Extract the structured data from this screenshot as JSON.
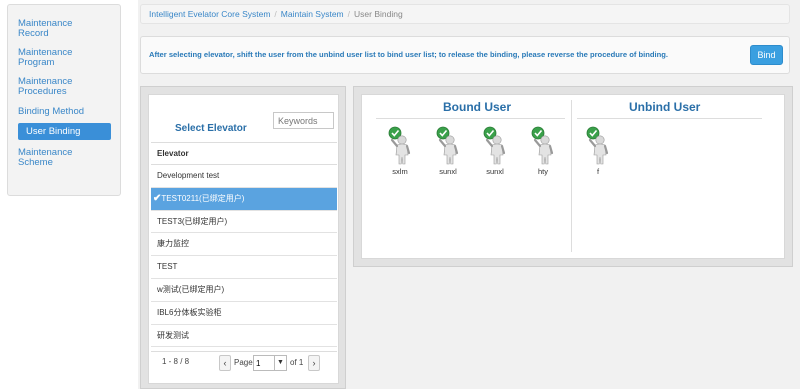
{
  "sidebar": {
    "items": [
      {
        "line1": "Maintenance",
        "line2": "Record"
      },
      {
        "line1": "Maintenance",
        "line2": "Program"
      },
      {
        "line1": "Maintenance",
        "line2": "Procedures"
      },
      {
        "line1": "Binding Method",
        "line2": ""
      },
      {
        "line1": "User Binding",
        "line2": ""
      },
      {
        "line1": "Maintenance",
        "line2": "Scheme"
      }
    ],
    "active_index": 4
  },
  "breadcrumb": {
    "items": [
      "Intelligent Evelator Core System",
      "Maintain System",
      "User Binding"
    ],
    "separator": "/"
  },
  "notice": {
    "text": "After selecting elevator, shift the user from the unbind user list to bind user list; to release the binding, please reverse the procedure of binding.",
    "bind_label": "Bind"
  },
  "elevator_panel": {
    "title": "Select Elevator",
    "keyword_placeholder": "Keywords",
    "column_header": "Elevator",
    "rows": [
      "Development test",
      "TEST0211(已绑定用户)",
      "TEST3(已绑定用户)",
      "康力监控",
      "TEST",
      "w测试(已绑定用户)",
      "IBL6分体板实验柜",
      "研发测试"
    ],
    "selected_index": 1,
    "pager": {
      "count": "1 - 8 / 8",
      "page_label": "Page",
      "page_value": "1",
      "of_label": "of 1",
      "prev": "‹",
      "next": "›",
      "dropdown": "▼"
    }
  },
  "user_panel": {
    "bound_title": "Bound User",
    "unbind_title": "Unbind User",
    "bound_users": [
      "sxlm",
      "sunxl",
      "sunxl",
      "hty"
    ],
    "unbind_users": [
      "f"
    ]
  },
  "colors": {
    "accent": "#3a8fd8",
    "link": "#3a87c8",
    "title": "#2a6fa8",
    "check": "#3aa04a"
  }
}
